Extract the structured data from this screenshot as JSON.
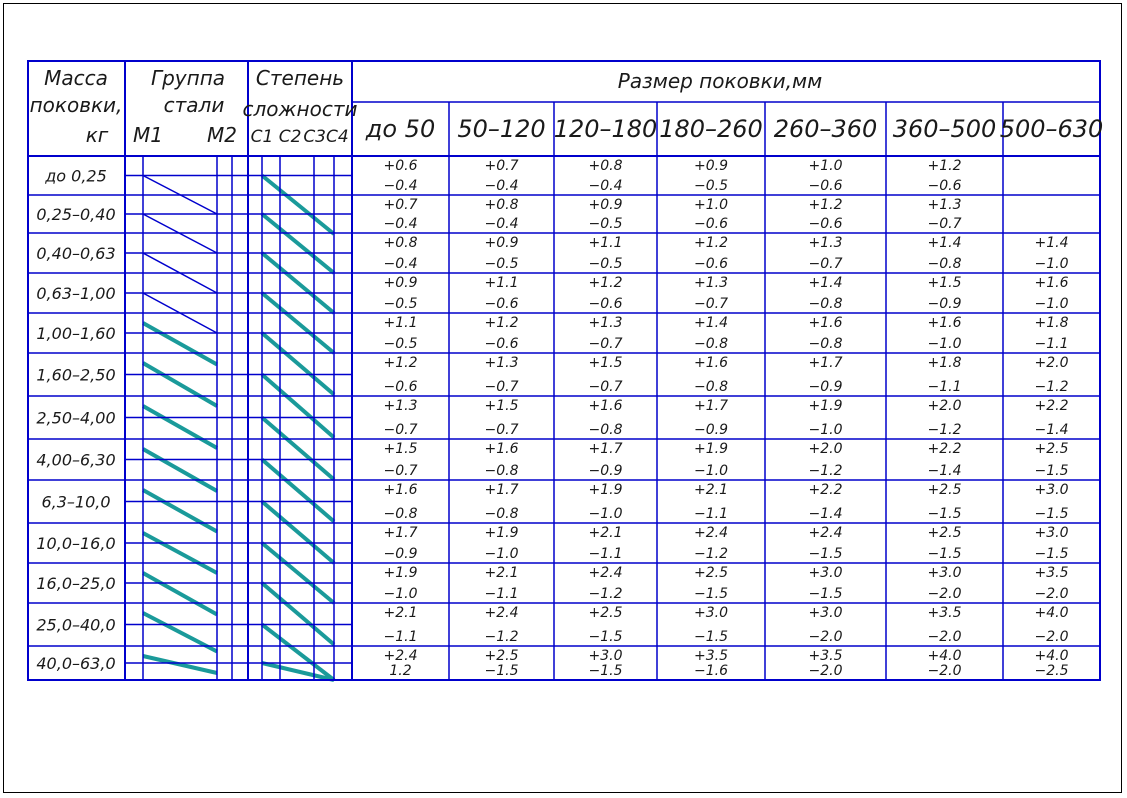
{
  "header": {
    "mass_title": "Масса поковки, кг",
    "mass_l1": "Масса",
    "mass_l2": "поковки,",
    "mass_l3": "кг",
    "group_l1": "Группа",
    "group_l2": "стали",
    "group_m1": "M1",
    "group_m2": "M2",
    "degree_l1": "Степень",
    "degree_l2": "сложности",
    "degree_c12": "C1 C2",
    "degree_c34": "C3C4",
    "size_title": "Размер поковки,мм",
    "size_ranges": [
      "до 50",
      "50–120",
      "120–180",
      "180–260",
      "260–360",
      "360–500",
      "500–630"
    ]
  },
  "rows": [
    {
      "mass": "до 0,25",
      "vals": [
        [
          "+0.6",
          "−0.4"
        ],
        [
          "+0.7",
          "−0.4"
        ],
        [
          "+0.8",
          "−0.4"
        ],
        [
          "+0.9",
          "−0.5"
        ],
        [
          "+1.0",
          "−0.6"
        ],
        [
          "+1.2",
          "−0.6"
        ],
        [
          "",
          ""
        ]
      ]
    },
    {
      "mass": "0,25–0,40",
      "vals": [
        [
          "+0.7",
          "−0.4"
        ],
        [
          "+0.8",
          "−0.4"
        ],
        [
          "+0.9",
          "−0.5"
        ],
        [
          "+1.0",
          "−0.6"
        ],
        [
          "+1.2",
          "−0.6"
        ],
        [
          "+1.3",
          "−0.7"
        ],
        [
          "",
          ""
        ]
      ]
    },
    {
      "mass": "0,40–0,63",
      "vals": [
        [
          "+0.8",
          "−0.4"
        ],
        [
          "+0.9",
          "−0.5"
        ],
        [
          "+1.1",
          "−0.5"
        ],
        [
          "+1.2",
          "−0.6"
        ],
        [
          "+1.3",
          "−0.7"
        ],
        [
          "+1.4",
          "−0.8"
        ],
        [
          "+1.4",
          "−1.0"
        ]
      ]
    },
    {
      "mass": "0,63–1,00",
      "vals": [
        [
          "+0.9",
          "−0.5"
        ],
        [
          "+1.1",
          "−0.6"
        ],
        [
          "+1.2",
          "−0.6"
        ],
        [
          "+1.3",
          "−0.7"
        ],
        [
          "+1.4",
          "−0.8"
        ],
        [
          "+1.5",
          "−0.9"
        ],
        [
          "+1.6",
          "−1.0"
        ]
      ]
    },
    {
      "mass": "1,00–1,60",
      "vals": [
        [
          "+1.1",
          "−0.5"
        ],
        [
          "+1.2",
          "−0.6"
        ],
        [
          "+1.3",
          "−0.7"
        ],
        [
          "+1.4",
          "−0.8"
        ],
        [
          "+1.6",
          "−0.8"
        ],
        [
          "+1.6",
          "−1.0"
        ],
        [
          "+1.8",
          "−1.1"
        ]
      ]
    },
    {
      "mass": "1,60–2,50",
      "vals": [
        [
          "+1.2",
          "−0.6"
        ],
        [
          "+1.3",
          "−0.7"
        ],
        [
          "+1.5",
          "−0.7"
        ],
        [
          "+1.6",
          "−0.8"
        ],
        [
          "+1.7",
          "−0.9"
        ],
        [
          "+1.8",
          "−1.1"
        ],
        [
          "+2.0",
          "−1.2"
        ]
      ]
    },
    {
      "mass": "2,50–4,00",
      "vals": [
        [
          "+1.3",
          "−0.7"
        ],
        [
          "+1.5",
          "−0.7"
        ],
        [
          "+1.6",
          "−0.8"
        ],
        [
          "+1.7",
          "−0.9"
        ],
        [
          "+1.9",
          "−1.0"
        ],
        [
          "+2.0",
          "−1.2"
        ],
        [
          "+2.2",
          "−1.4"
        ]
      ]
    },
    {
      "mass": "4,00–6,30",
      "vals": [
        [
          "+1.5",
          "−0.7"
        ],
        [
          "+1.6",
          "−0.8"
        ],
        [
          "+1.7",
          "−0.9"
        ],
        [
          "+1.9",
          "−1.0"
        ],
        [
          "+2.0",
          "−1.2"
        ],
        [
          "+2.2",
          "−1.4"
        ],
        [
          "+2.5",
          "−1.5"
        ]
      ]
    },
    {
      "mass": "6,3–10,0",
      "vals": [
        [
          "+1.6",
          "−0.8"
        ],
        [
          "+1.7",
          "−0.8"
        ],
        [
          "+1.9",
          "−1.0"
        ],
        [
          "+2.1",
          "−1.1"
        ],
        [
          "+2.2",
          "−1.4"
        ],
        [
          "+2.5",
          "−1.5"
        ],
        [
          "+3.0",
          "−1.5"
        ]
      ]
    },
    {
      "mass": "10,0–16,0",
      "vals": [
        [
          "+1.7",
          "−0.9"
        ],
        [
          "+1.9",
          "−1.0"
        ],
        [
          "+2.1",
          "−1.1"
        ],
        [
          "+2.4",
          "−1.2"
        ],
        [
          "+2.4",
          "−1.5"
        ],
        [
          "+2.5",
          "−1.5"
        ],
        [
          "+3.0",
          "−1.5"
        ]
      ]
    },
    {
      "mass": "16,0–25,0",
      "vals": [
        [
          "+1.9",
          "−1.0"
        ],
        [
          "+2.1",
          "−1.1"
        ],
        [
          "+2.4",
          "−1.2"
        ],
        [
          "+2.5",
          "−1.5"
        ],
        [
          "+3.0",
          "−1.5"
        ],
        [
          "+3.0",
          "−2.0"
        ],
        [
          "+3.5",
          "−2.0"
        ]
      ]
    },
    {
      "mass": "25,0–40,0",
      "vals": [
        [
          "+2.1",
          "−1.1"
        ],
        [
          "+2.4",
          "−1.2"
        ],
        [
          "+2.5",
          "−1.5"
        ],
        [
          "+3.0",
          "−1.5"
        ],
        [
          "+3.0",
          "−2.0"
        ],
        [
          "+3.5",
          "−2.0"
        ],
        [
          "+4.0",
          "−2.0"
        ]
      ]
    },
    {
      "mass": "40,0–63,0",
      "vals": [
        [
          "+2.4",
          "1.2"
        ],
        [
          "+2.5",
          "−1.5"
        ],
        [
          "+3.0",
          "−1.5"
        ],
        [
          "+3.5",
          "−1.6"
        ],
        [
          "+3.5",
          "−2.0"
        ],
        [
          "+4.0",
          "−2.0"
        ],
        [
          "+4.0",
          "−2.5"
        ]
      ]
    }
  ],
  "colors": {
    "grid": "#0000cc",
    "diagonal_thick": "#1a9a9a",
    "diagonal_thin": "#0000cc",
    "text": "#1a1a1a"
  }
}
